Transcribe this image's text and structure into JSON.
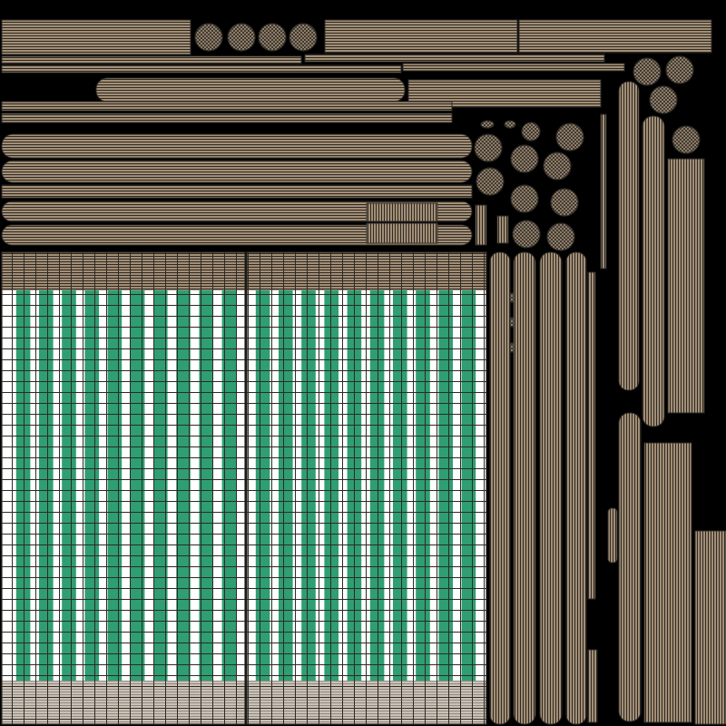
{
  "colors": {
    "background": "#000000",
    "wood": "#a38e74",
    "wood_dark": "#6e5c48",
    "wire": "#2d2a26",
    "canvas_white": "#ffffff",
    "canvas_green": "#2f9e72"
  },
  "panels": {
    "awning_left": {
      "stripe_count": 10
    },
    "awning_right": {
      "stripe_count": 10
    }
  }
}
